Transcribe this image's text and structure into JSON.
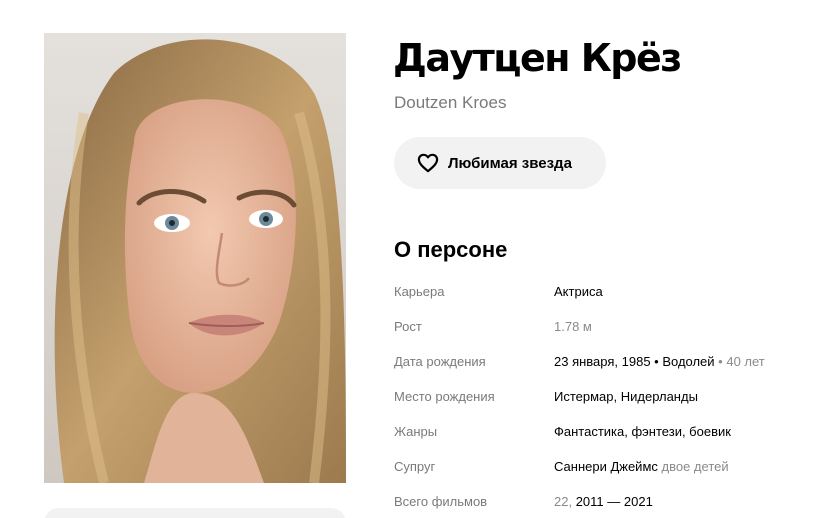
{
  "person": {
    "name_ru": "Даутцен Крёз",
    "name_en": "Doutzen Kroes"
  },
  "favorite_button": {
    "label": "Любимая звезда",
    "icon": "heart-icon"
  },
  "about": {
    "title": "О персоне",
    "rows": [
      {
        "key": "Карьера",
        "value": "Актриса"
      },
      {
        "key": "Рост",
        "value": "1.78 м"
      },
      {
        "key": "Дата рождения",
        "value": "23 января, 1985 • Водолей",
        "extra": "• 40 лет"
      },
      {
        "key": "Место рождения",
        "value": "Истермар, Нидерланды"
      },
      {
        "key": "Жанры",
        "value": "Фантастика, фэнтези, боевик"
      },
      {
        "key": "Супруг",
        "value": "Саннери Джеймс",
        "extra": "двое детей"
      },
      {
        "key": "Всего фильмов",
        "value_muted": "22,",
        "value": "2011 — 2021"
      }
    ]
  },
  "colors": {
    "text": "#000000",
    "muted": "#7a7a7a",
    "button_bg": "#f2f2f2"
  }
}
